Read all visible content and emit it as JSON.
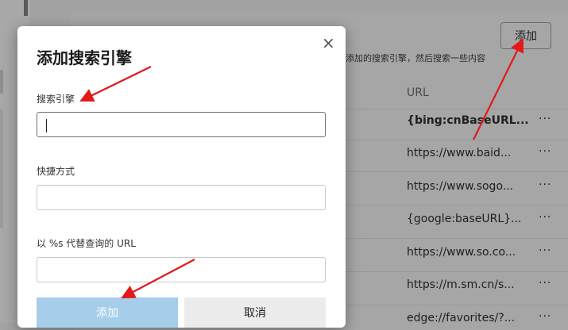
{
  "background": {
    "add_button_label": "添加",
    "description": "要添加的搜索引擎，然后搜索一些内容",
    "url_header": "URL",
    "more_label": "···",
    "engines": [
      {
        "url": "{bing:cnBaseURL...",
        "bold": true
      },
      {
        "url": "https://www.baid...",
        "bold": false
      },
      {
        "url": "https://www.sogo...",
        "bold": false
      },
      {
        "url": "{google:baseURL}...",
        "bold": false
      },
      {
        "url": "https://www.so.co...",
        "bold": false
      },
      {
        "url": "https://m.sm.cn/s...",
        "bold": false
      },
      {
        "url": "edge://favorites/?...",
        "bold": false
      }
    ]
  },
  "dialog": {
    "title": "添加搜索引擎",
    "close_label": "×",
    "fields": [
      {
        "label": "搜索引擎",
        "value": ""
      },
      {
        "label": "快捷方式",
        "value": ""
      },
      {
        "label": "以 %s 代替查询的 URL",
        "value": ""
      }
    ],
    "add_button": "添加",
    "cancel_button": "取消"
  },
  "colors": {
    "annotation_arrow": "#e11919",
    "add_button_disabled": "#a6cdea"
  }
}
